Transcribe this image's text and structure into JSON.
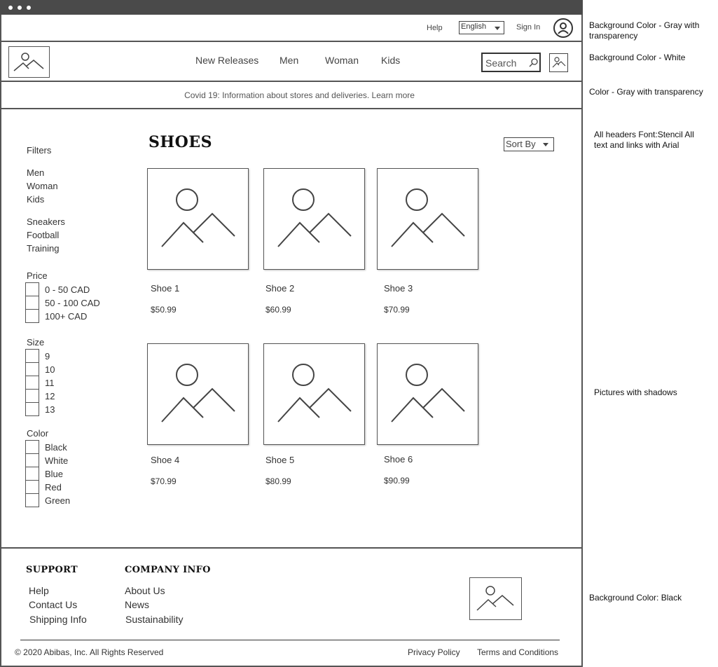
{
  "util": {
    "help_label": "Help",
    "language_value": "English",
    "signin_label": "Sign In"
  },
  "nav": {
    "items": [
      "New Releases",
      "Men",
      "Woman",
      "Kids"
    ],
    "search_placeholder": "Search"
  },
  "covid": {
    "text": "Covid 19: Information about stores and deliveries. Learn more"
  },
  "sidebar": {
    "filters_label": "Filters",
    "genders": [
      "Men",
      "Woman",
      "Kids"
    ],
    "categories": [
      "Sneakers",
      "Football",
      "Training"
    ],
    "price": {
      "label": "Price",
      "options": [
        "0 - 50 CAD",
        "50 - 100 CAD",
        "100+ CAD"
      ]
    },
    "size": {
      "label": "Size",
      "options": [
        "9",
        "10",
        "11",
        "12",
        "13"
      ]
    },
    "color": {
      "label": "Color",
      "options": [
        "Black",
        "White",
        "Blue",
        "Red",
        "Green"
      ]
    }
  },
  "main": {
    "title": "SHOES",
    "sort_label": "Sort By",
    "products": [
      {
        "name": "Shoe 1",
        "price": "$50.99"
      },
      {
        "name": "Shoe 2",
        "price": "$60.99"
      },
      {
        "name": "Shoe 3",
        "price": "$70.99"
      },
      {
        "name": "Shoe 4",
        "price": "$70.99"
      },
      {
        "name": "Shoe 5",
        "price": "$80.99"
      },
      {
        "name": "Shoe 6",
        "price": "$90.99"
      }
    ]
  },
  "footer": {
    "support": {
      "heading": "SUPPORT",
      "links": [
        "Help",
        "Contact Us",
        "Shipping Info"
      ]
    },
    "company": {
      "heading": "COMPANY INFO",
      "links": [
        "About Us",
        "News",
        "Sustainability"
      ]
    },
    "copyright": "© 2020 Abibas, Inc. All Rights Reserved",
    "privacy": "Privacy Policy",
    "terms": "Terms and Conditions"
  },
  "annotations": {
    "util_bg": "Background Color - Gray with transparency",
    "nav_bg": "Background Color - White",
    "covid_color": "Color - Gray with transparency",
    "fonts": "All headers Font:Stencil All text and links with Arial",
    "pictures": "Pictures with shadows",
    "footer_bg": "Background Color: Black"
  },
  "icons": {
    "user": "user-circle-icon",
    "search": "search-icon",
    "logo": "image-placeholder-icon",
    "dropdown": "caret-down-icon"
  }
}
